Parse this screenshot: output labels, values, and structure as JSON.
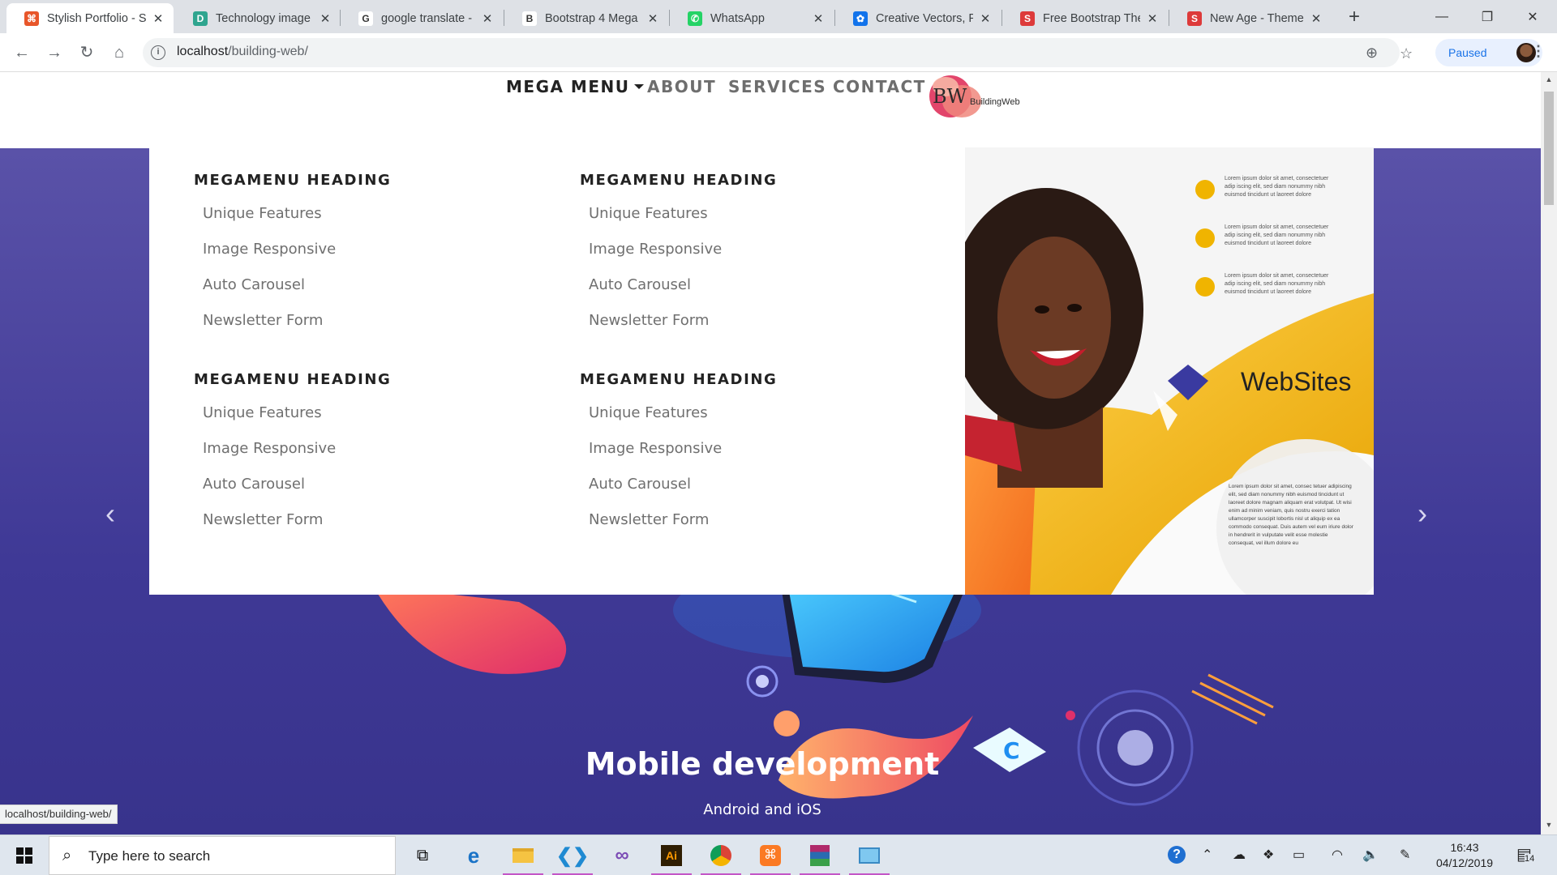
{
  "browser": {
    "tabs": [
      {
        "title": "Stylish Portfolio - S",
        "favicon": "codeigniter-icon",
        "fav_color": "#e8562a",
        "fav_glyph": "⌘",
        "active": true
      },
      {
        "title": "Technology image",
        "favicon": "dreamstime-icon",
        "fav_color": "#2fa58f",
        "fav_glyph": "D"
      },
      {
        "title": "google translate -",
        "favicon": "google-icon",
        "fav_color": "#ffffff",
        "fav_glyph": "G"
      },
      {
        "title": "Bootstrap 4 Mega",
        "favicon": "bootstrap-icon",
        "fav_color": "#ffffff",
        "fav_glyph": "B"
      },
      {
        "title": "WhatsApp",
        "favicon": "whatsapp-icon",
        "fav_color": "#25d366",
        "fav_glyph": "✆"
      },
      {
        "title": "Creative Vectors, P",
        "favicon": "freepik-icon",
        "fav_color": "#1273eb",
        "fav_glyph": "✿"
      },
      {
        "title": "Free Bootstrap The",
        "favicon": "startbootstrap-icon",
        "fav_color": "#dd3a3a",
        "fav_glyph": "S"
      },
      {
        "title": "New Age - Theme",
        "favicon": "startbootstrap-icon",
        "fav_color": "#dd3a3a",
        "fav_glyph": "S"
      }
    ],
    "url_host": "localhost",
    "url_path": "/building-web/",
    "profile_label": "Paused",
    "status_url": "localhost/building-web/"
  },
  "site": {
    "nav": {
      "mega_menu": "MEGA MENU",
      "about": "ABOUT",
      "services": "SERVICES",
      "contact": "CONTACT"
    },
    "logo": {
      "initials": "BW",
      "name": "BuildingWeb"
    },
    "megamenu": {
      "columns": [
        {
          "heading": "MEGAMENU HEADING",
          "links": [
            "Unique Features",
            "Image Responsive",
            "Auto Carousel",
            "Newsletter Form"
          ]
        },
        {
          "heading": "MEGAMENU HEADING",
          "links": [
            "Unique Features",
            "Image Responsive",
            "Auto Carousel",
            "Newsletter Form"
          ]
        },
        {
          "heading": "MEGAMENU HEADING",
          "links": [
            "Unique Features",
            "Image Responsive",
            "Auto Carousel",
            "Newsletter Form"
          ]
        },
        {
          "heading": "MEGAMENU HEADING",
          "links": [
            "Unique Features",
            "Image Responsive",
            "Auto Carousel",
            "Newsletter Form"
          ]
        }
      ],
      "image_brand": "WebSites",
      "image_blurb": "Lorem ipsum dolor sit amet, consectetuer adip iscing elit, sed diam nonummy nibh euismod tincidunt ut laoreet dolore",
      "image_paragraph": "Lorem ipsum dolor sit amet, consec tetuer adipiscing elit, sed diam nonummy nibh euismod tincidunt ut laoreet dolore magnam aliquam erat volutpat. Ut wisi enim ad minim veniam, quis nostru exerci tation ullamcorper suscipit lobortis nisl ut aliquip ex ea commodo consequat. Duis autem vel eum iriure dolor in hendrerit in vulputate velit esse molestie consequat, vel illum dolore eu"
    },
    "hero": {
      "title": "Mobile development",
      "subtitle": "Android and iOS",
      "prev": "‹",
      "next": "›"
    }
  },
  "taskbar": {
    "search_placeholder": "Type here to search",
    "time": "16:43",
    "date": "04/12/2019",
    "notification_count": "14"
  },
  "colors": {
    "hero_bg": "#4a4399",
    "nav_active": "#222222",
    "nav_muted": "#6e6e6e",
    "accent_gold": "#f0b400",
    "logo_pink": "#e2456b"
  }
}
